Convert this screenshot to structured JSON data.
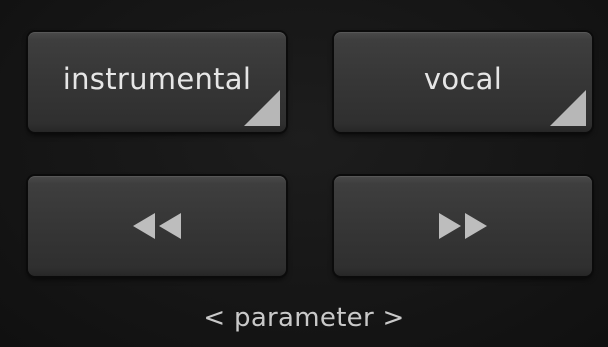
{
  "pads": {
    "instrumental": {
      "label": "instrumental",
      "has_shift_corner": true
    },
    "vocal": {
      "label": "vocal",
      "has_shift_corner": true
    },
    "rewind": {
      "icon": "rewind-icon"
    },
    "fast_forward": {
      "icon": "fast-forward-icon"
    }
  },
  "footer": {
    "parameter_label": "< parameter >"
  },
  "colors": {
    "background": "#151515",
    "pad": "#363636",
    "label_text": "#e6e6e6",
    "icon": "#bdbdbd"
  }
}
